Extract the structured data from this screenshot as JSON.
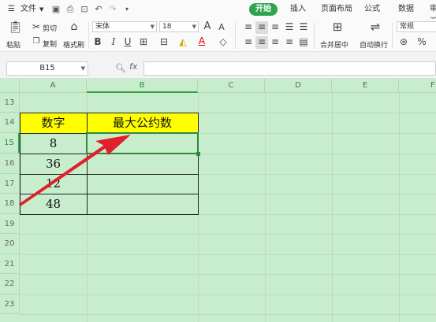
{
  "menu": {
    "file": "文件",
    "tabs": [
      "开始",
      "插入",
      "页面布局",
      "公式",
      "数据",
      "审阅"
    ]
  },
  "ribbon": {
    "paste": "粘贴",
    "cut": "剪切",
    "copy": "复制",
    "format_painter": "格式刷",
    "font_name": "宋体",
    "font_size": "18",
    "bold": "B",
    "italic": "I",
    "underline": "U",
    "font_grow": "A",
    "font_shrink": "A",
    "font_color_glyph": "A",
    "merge_center": "合并居中",
    "wrap_text": "自动换行",
    "number_format": "常规",
    "percent": "%"
  },
  "formula_bar": {
    "name_box": "B15",
    "fx": "fx",
    "formula": ""
  },
  "columns": [
    "A",
    "B",
    "C",
    "D",
    "E",
    "F"
  ],
  "rows": [
    "13",
    "14",
    "15",
    "16",
    "17",
    "18",
    "19",
    "20",
    "21",
    "22",
    "23"
  ],
  "table": {
    "header_a": "数字",
    "header_b": "最大公约数",
    "values": [
      "8",
      "36",
      "12",
      "48"
    ]
  },
  "colors": {
    "accent": "#2ea44f",
    "sheet_bg": "#c7edcc",
    "header_fill": "#ffff00",
    "arrow": "#e0202a"
  }
}
